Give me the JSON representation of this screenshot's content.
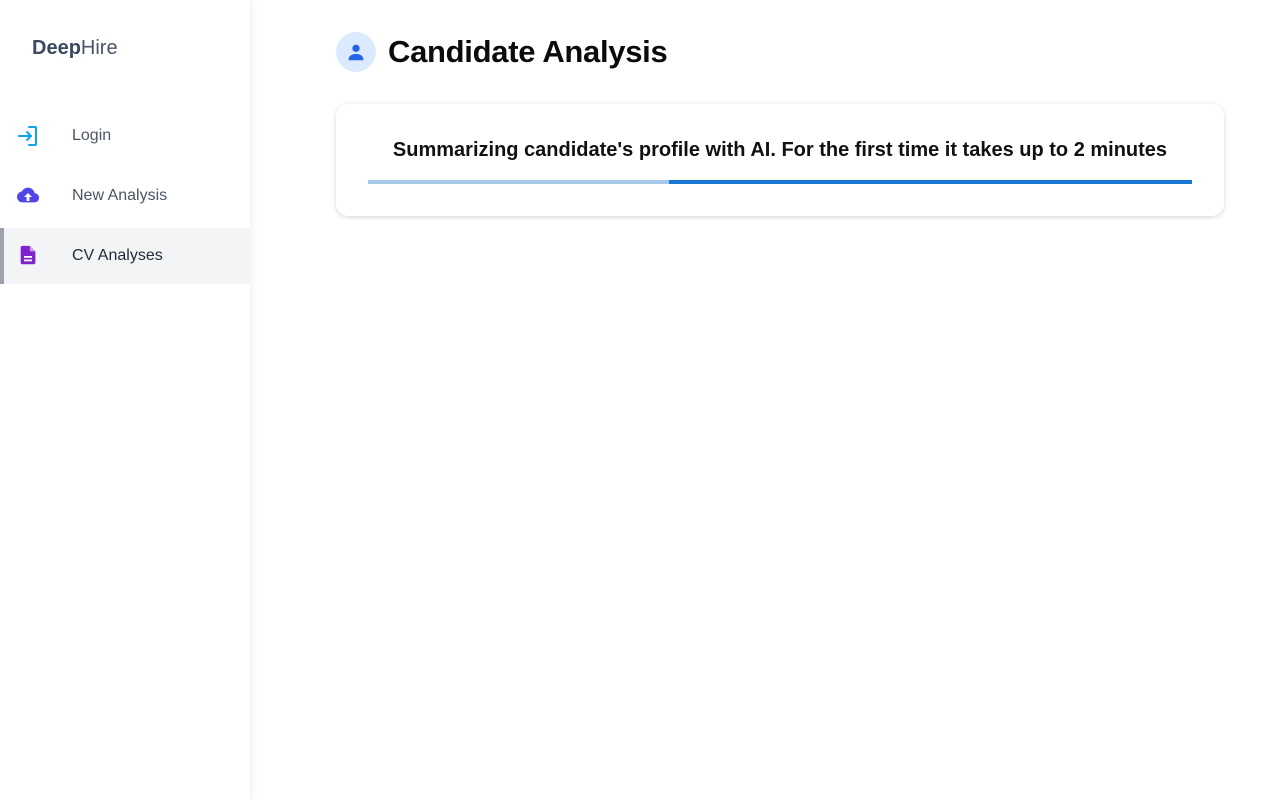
{
  "brand": {
    "bold": "Deep",
    "light": "Hire"
  },
  "sidebar": {
    "items": [
      {
        "label": "Login",
        "icon": "login-icon",
        "active": false
      },
      {
        "label": "New Analysis",
        "icon": "cloud-upload-icon",
        "active": false
      },
      {
        "label": "CV Analyses",
        "icon": "document-icon",
        "active": true
      }
    ]
  },
  "header": {
    "title": "Candidate Analysis",
    "avatar_icon": "person-icon"
  },
  "status_card": {
    "message": "Summarizing candidate's profile with AI. For the first time it takes up to 2 minutes",
    "progress_fraction": 0.365
  },
  "colors": {
    "login_icon": "#0ea5e9",
    "upload_icon": "#4f46e5",
    "document_icon": "#7e22ce",
    "avatar_bg": "#dbeafe",
    "avatar_icon": "#2563eb",
    "progress_track": "#1976d2",
    "progress_fill": "#a7c9ea"
  }
}
